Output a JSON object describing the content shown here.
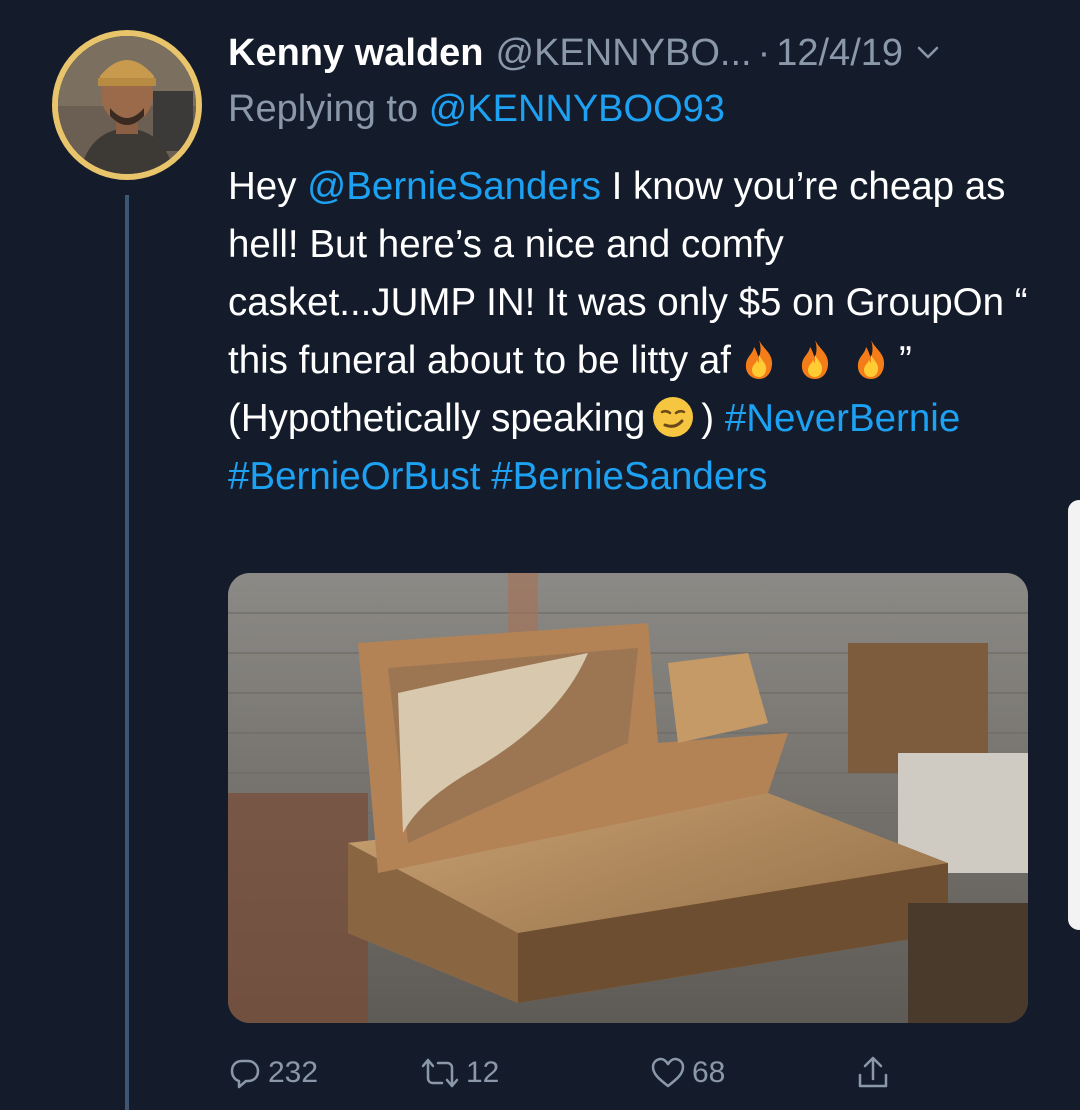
{
  "tweet": {
    "display_name": "Kenny walden",
    "handle": "@KENNYBO...",
    "separator": "·",
    "date": "12/4/19",
    "replying_prefix": "Replying to",
    "replying_handle": "@KENNYBOO93",
    "text": {
      "t1": "Hey ",
      "mention": "@BernieSanders",
      "t2": " I know you’re cheap as hell! But here’s a nice and comfy casket...JUMP IN! It was only $5 on GroupOn “ this funeral about to be litty af",
      "t3": "” (Hypothetically speaking",
      "t4": ") ",
      "hashtag1": "#NeverBernie",
      "hashtag2": "#BernieOrBust",
      "hashtag3": "#BernieSanders"
    },
    "emoji_names": [
      "fire-emoji",
      "fire-emoji",
      "fire-emoji",
      "smirking-face-emoji"
    ]
  },
  "actions": {
    "reply_count": "232",
    "retweet_count": "12",
    "like_count": "68",
    "icons": [
      "reply-icon",
      "retweet-icon",
      "heart-icon",
      "share-icon"
    ]
  },
  "colors": {
    "background": "#141c2b",
    "link": "#1da1f2",
    "muted": "#8a98aa",
    "avatar_ring": "#e8c46a"
  }
}
